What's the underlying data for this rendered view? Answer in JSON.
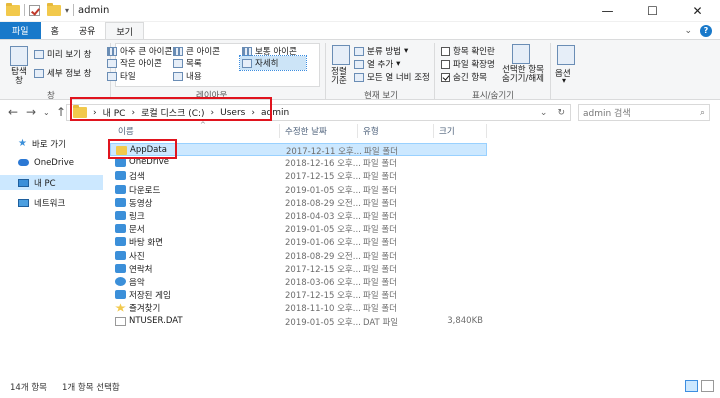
{
  "window": {
    "title": "admin",
    "controls": {
      "minimize": "—",
      "maximize": "☐",
      "close": "✕"
    }
  },
  "tabs": [
    "파일",
    "홈",
    "공유",
    "보기"
  ],
  "ribbon": {
    "pane_group": {
      "label": "창",
      "nav_pane": "탐색 창",
      "preview_pane": "미리 보기 창",
      "details_pane": "세부 정보 창"
    },
    "layout_group": {
      "label": "레이아웃",
      "items": [
        "아주 큰 아이콘",
        "큰 아이콘",
        "보통 아이콘",
        "작은 아이콘",
        "목록",
        "자세히",
        "타일",
        "내용"
      ],
      "selected": "자세히"
    },
    "view_group": {
      "label": "현재 보기",
      "sort": "정렬 기준",
      "group_by": "분류 방법",
      "add_column": "열 추가",
      "fit_columns": "모든 열 너비 조정"
    },
    "showhide_group": {
      "label": "표시/숨기기",
      "item_checkboxes": "항목 확인란",
      "file_extensions": "파일 확장명",
      "hidden_items": "숨긴 항목",
      "hide_selected": "선택한 항목 숨기기/해제"
    },
    "options": "옵션"
  },
  "address": {
    "path": [
      "내 PC",
      "로컬 디스크 (C:)",
      "Users",
      "admin"
    ],
    "search_placeholder": "admin 검색"
  },
  "sidebar": {
    "items": [
      {
        "label": "바로 가기",
        "icon": "star-icon"
      },
      {
        "label": "OneDrive",
        "icon": "cloud-icon"
      },
      {
        "label": "내 PC",
        "icon": "pc-icon",
        "selected": true
      },
      {
        "label": "네트워크",
        "icon": "network-icon"
      }
    ]
  },
  "columns": {
    "name": "이름",
    "date": "수정한 날짜",
    "type": "유형",
    "size": "크기"
  },
  "files": [
    {
      "name": "AppData",
      "date": "2017-12-11 오후...",
      "type": "파일 폴더",
      "size": "",
      "icon": "folder",
      "selected": true
    },
    {
      "name": "OneDrive",
      "date": "2018-12-16 오후...",
      "type": "파일 폴더",
      "size": "",
      "icon": "blue"
    },
    {
      "name": "검색",
      "date": "2017-12-15 오후...",
      "type": "파일 폴더",
      "size": "",
      "icon": "blue"
    },
    {
      "name": "다운로드",
      "date": "2019-01-05 오후...",
      "type": "파일 폴더",
      "size": "",
      "icon": "blue"
    },
    {
      "name": "동영상",
      "date": "2018-08-29 오전...",
      "type": "파일 폴더",
      "size": "",
      "icon": "blue"
    },
    {
      "name": "링크",
      "date": "2018-04-03 오후...",
      "type": "파일 폴더",
      "size": "",
      "icon": "blue"
    },
    {
      "name": "문서",
      "date": "2019-01-05 오후...",
      "type": "파일 폴더",
      "size": "",
      "icon": "blue"
    },
    {
      "name": "바탕 화면",
      "date": "2019-01-06 오후...",
      "type": "파일 폴더",
      "size": "",
      "icon": "blue"
    },
    {
      "name": "사진",
      "date": "2018-08-29 오전...",
      "type": "파일 폴더",
      "size": "",
      "icon": "blue"
    },
    {
      "name": "연락처",
      "date": "2017-12-15 오후...",
      "type": "파일 폴더",
      "size": "",
      "icon": "blue"
    },
    {
      "name": "음악",
      "date": "2018-03-06 오후...",
      "type": "파일 폴더",
      "size": "",
      "icon": "note"
    },
    {
      "name": "저장된 게임",
      "date": "2017-12-15 오후...",
      "type": "파일 폴더",
      "size": "",
      "icon": "blue"
    },
    {
      "name": "즐겨찾기",
      "date": "2018-11-10 오후...",
      "type": "파일 폴더",
      "size": "",
      "icon": "star"
    },
    {
      "name": "NTUSER.DAT",
      "date": "2019-01-05 오후...",
      "type": "DAT 파일",
      "size": "3,840KB",
      "icon": "file"
    }
  ],
  "status": {
    "count": "14개 항목",
    "selected": "1개 항목 선택함"
  }
}
